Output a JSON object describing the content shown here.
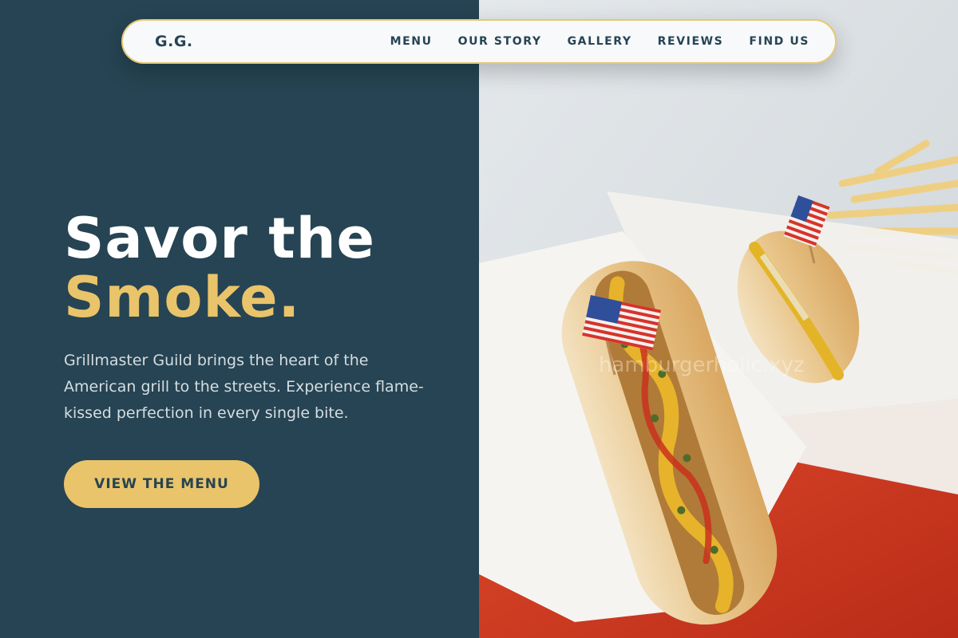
{
  "nav": {
    "logo": "G.G.",
    "links": [
      "MENU",
      "OUR STORY",
      "GALLERY",
      "REVIEWS",
      "FIND US"
    ]
  },
  "hero": {
    "headline_line1": "Savor the",
    "headline_line2": "Smoke.",
    "description": "Grillmaster Guild brings the heart of the American grill to the streets. Experience flame-kissed perfection in every single bite.",
    "cta_label": "VIEW THE MENU"
  },
  "photo": {
    "alt": "Two hot dogs with mustard and relish topped with small American flags on a red tray with fries",
    "watermark": "hamburgerholic.xyz"
  },
  "colors": {
    "navy": "#264453",
    "gold": "#e9c46a",
    "nav_bg": "#f7f9fb",
    "tray_red": "#d63a22"
  }
}
